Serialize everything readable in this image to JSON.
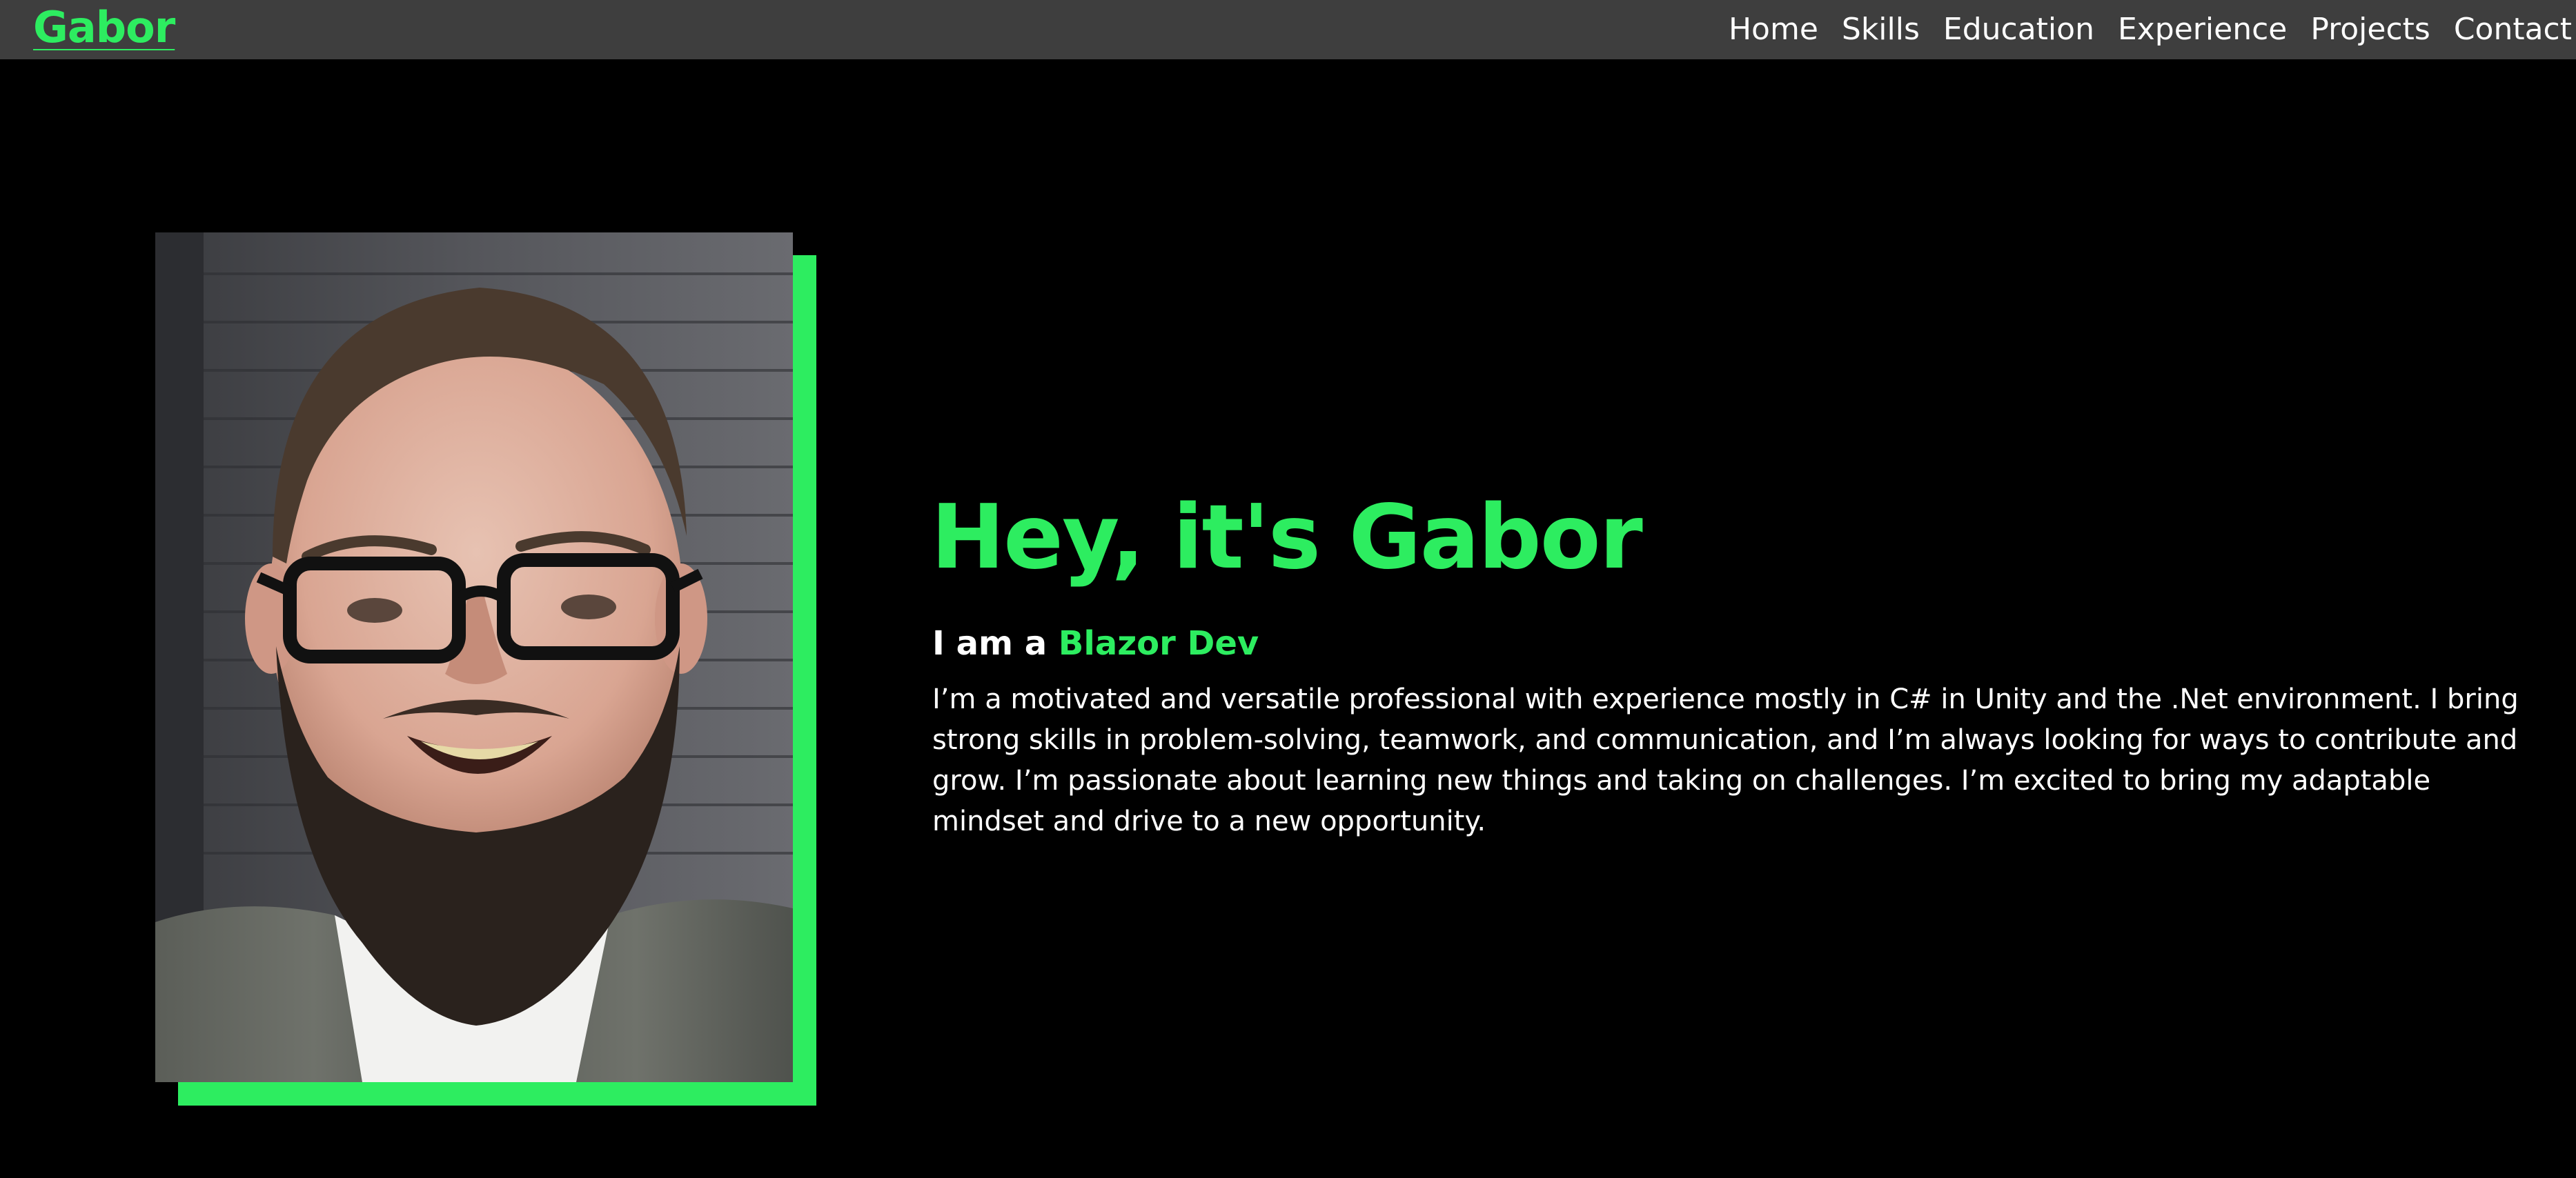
{
  "brand": {
    "name": "Gabor"
  },
  "nav": {
    "items": [
      {
        "label": "Home"
      },
      {
        "label": "Skills"
      },
      {
        "label": "Education"
      },
      {
        "label": "Experience"
      },
      {
        "label": "Projects"
      },
      {
        "label": "Contact"
      }
    ]
  },
  "hero": {
    "title": "Hey, it's Gabor",
    "subtitle_prefix": "I am a ",
    "role": "Blazor Dev",
    "description": "I’m a motivated and versatile professional with experience mostly in C# in Unity and the .Net environment. I bring strong skills in problem-solving, teamwork, and communication, and I’m always looking for ways to contribute and grow. I’m passionate about learning new things and taking on challenges. I’m excited to bring my adaptable mindset and drive to a new opportunity."
  },
  "colors": {
    "accent": "#2ded60",
    "navbar_bg": "#3e3e3e",
    "page_bg": "#000000",
    "text": "#ffffff"
  }
}
